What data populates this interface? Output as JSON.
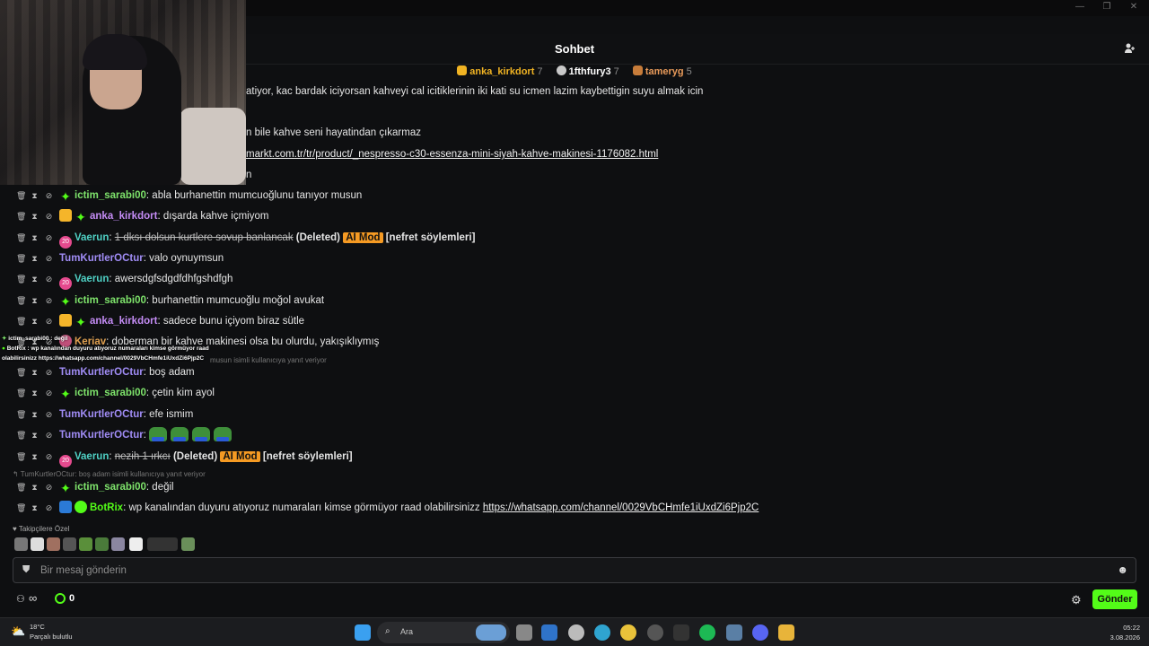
{
  "header": {
    "title": "Sohbet",
    "user_icon": "users-icon"
  },
  "leaderboard": [
    {
      "rank_color": "#f0b323",
      "name": "anka_kirkdort",
      "name_color": "#f0b323",
      "count": "7"
    },
    {
      "rank_color": "#c9c9c9",
      "name": "1fthfury3",
      "name_color": "#ffffff",
      "count": "7"
    },
    {
      "rank_color": "#c77c3a",
      "name": "tameryg",
      "name_color": "#e89a5a",
      "count": "5"
    }
  ],
  "partial_lines": [
    "atiyor, kac bardak iciyorsan kahveyi cal icitiklerinin iki kati su icmen lazim kaybettigin suyu almak icin",
    "n bile kahve seni hayatindan çıkarmaz",
    "markt.com.tr/tr/product/_nespresso-c30-essenza-mini-siyah-kahve-makinesi-1176082.html",
    "n"
  ],
  "messages": [
    {
      "user": "ictim_sarabi00",
      "color": "#7ee36b",
      "text": ": abla burhanettin mumcuoğlunu tanıyor musun"
    },
    {
      "user": "anka_kirkdort",
      "color": "#c48cf5",
      "text": ": dışarda kahve içmiyom"
    },
    {
      "user": "Vaerun",
      "color": "#4fd1c5",
      "deleted_text": "1 dksı dolsun kurtlere sovup banlancak",
      "deleted_label": "(Deleted)",
      "ai": "AI Mod",
      "reason": "[nefret söylemleri]"
    },
    {
      "user": "TumKurtlerOCtur",
      "color": "#a08cf5",
      "text": ": valo oynuymsun"
    },
    {
      "user": "Vaerun",
      "color": "#4fd1c5",
      "text": ": awersdgfsdgdfdhfgshdfgh"
    },
    {
      "user": "ictim_sarabi00",
      "color": "#7ee36b",
      "text": ": burhanettin mumcuoğlu moğol avukat"
    },
    {
      "user": "anka_kirkdort",
      "color": "#c48cf5",
      "text": ": sadece bunu içiyom biraz sütle"
    },
    {
      "user": "Keriav",
      "color": "#e0a050",
      "text": ": doberman bir kahve makinesi olsa bu olurdu, yakışıklıymış"
    },
    {
      "user": "TumKurtlerOCtur",
      "color": "#a08cf5",
      "text": ": boş adam"
    },
    {
      "user": "ictim_sarabi00",
      "color": "#7ee36b",
      "text": ": çetin kim ayol"
    },
    {
      "user": "TumKurtlerOCtur",
      "color": "#a08cf5",
      "text": ": efe ismim"
    },
    {
      "user": "TumKurtlerOCtur",
      "color": "#a08cf5",
      "text": ":"
    },
    {
      "user": "Vaerun",
      "color": "#4fd1c5",
      "deleted_text": "nezih 1 ırkcı",
      "deleted_label": "(Deleted)",
      "ai": "AI Mod",
      "reason": "[nefret söylemleri]"
    },
    {
      "user": "ictim_sarabi00",
      "color": "#7ee36b",
      "text": ": değil"
    },
    {
      "user": "BotRix",
      "color": "#53fc18",
      "text": ": wp kanalından duyuru atıyoruz numaraları kimse görmüyor raad olabilirsinizz ",
      "link": "https://whatsapp.com/channel/0029VbCHmfe1iUxdZi6Pjp2C"
    }
  ],
  "replies": {
    "r1": "musun isimli kullanıcıya yanıt veriyor",
    "r2": "TumKurtlerOCtur: boş adam isimli kullanıcıya yanıt veriyor"
  },
  "overlay": {
    "line1": "ictim_sarabi00 : değil",
    "line2": "BotRix : wp kanalından duyuru atıyoruz numaraları kimse görmüyor raad",
    "line3": "olabilirsinizz https://whatsapp.com/channel/0029VbCHmfe1iUxdZi6Pjp2C"
  },
  "followers_label": "Takipçilere Özel",
  "input": {
    "placeholder": "Bir mesaj gönderin"
  },
  "footer": {
    "points": "0",
    "send_label": "Gönder",
    "infinity": "∞"
  },
  "taskbar": {
    "weather_temp": "18°C",
    "weather_desc": "Parçalı bulutlu",
    "search_label": "Ara",
    "time": "05:22",
    "date": "3.08.2026"
  }
}
